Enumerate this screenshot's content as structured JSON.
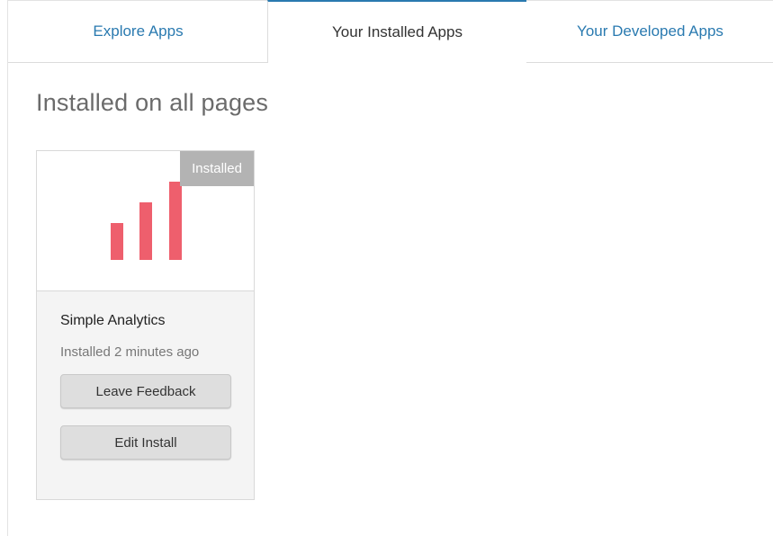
{
  "tabs": [
    {
      "label": "Explore Apps",
      "active": false
    },
    {
      "label": "Your Installed Apps",
      "active": true
    },
    {
      "label": "Your Developed Apps",
      "active": false
    }
  ],
  "section": {
    "title": "Installed on all pages"
  },
  "apps": [
    {
      "badge": "Installed",
      "name": "Simple Analytics",
      "status": "Installed 2 minutes ago",
      "logo_icon": "bar-chart-icon",
      "logo_color": "#ee5f6d",
      "buttons": {
        "feedback_label": "Leave Feedback",
        "edit_label": "Edit Install"
      }
    }
  ],
  "colors": {
    "accent": "#2a7ab0",
    "badge_bg": "#b3b3b3",
    "button_bg": "#dedede"
  }
}
